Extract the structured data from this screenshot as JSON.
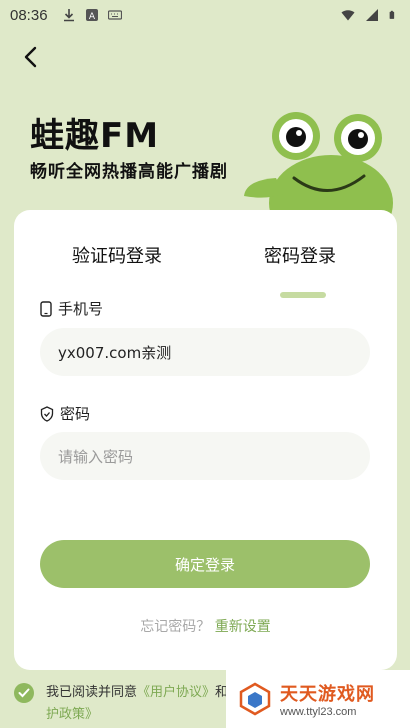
{
  "status_bar": {
    "time": "08:36",
    "icons": [
      "download-icon",
      "a-icon",
      "keyboard-icon"
    ],
    "right_icons": [
      "wifi-icon",
      "signal-icon",
      "battery-icon"
    ]
  },
  "header": {
    "back_icon": "back-arrow-icon",
    "brand_title": "蛙趣FM",
    "brand_subtitle": "畅听全网热播高能广播剧"
  },
  "login_card": {
    "tabs": [
      {
        "label": "验证码登录",
        "active": false
      },
      {
        "label": "密码登录",
        "active": true
      }
    ],
    "phone": {
      "label": "手机号",
      "value": "yx007.com亲测"
    },
    "password": {
      "label": "密码",
      "placeholder": "请输入密码"
    },
    "submit_label": "确定登录",
    "forgot_text": "忘记密码？",
    "reset_link": "重新设置"
  },
  "agreement": {
    "prefix": "我已阅读并同意",
    "user_agreement": "《用户协议》",
    "middle": "和",
    "privacy_suffix": "护政策》"
  },
  "watermark": {
    "title": "天天游戏网",
    "url": "www.ttyl23.com"
  },
  "colors": {
    "background": "#dfe9c9",
    "accent": "#9cc06a",
    "link": "#7ea953",
    "card": "#ffffff"
  }
}
